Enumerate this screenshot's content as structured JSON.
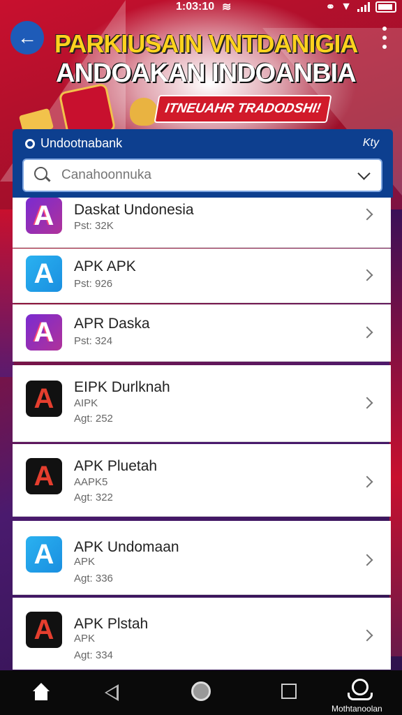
{
  "status_bar": {
    "time": "1:03:10"
  },
  "header": {
    "headline_line1": "PARKIUSAIN VNTDANIGIA",
    "headline_line2": "ANDOAKAN INDOANBIA",
    "promo_tag": "ITNEUAHR TRADODSHI!"
  },
  "panel": {
    "title": "Undootnabank",
    "right_label": "Kty",
    "search": {
      "placeholder": "Canahoonnuka"
    }
  },
  "apps": [
    {
      "title": "Daskat Undonesia",
      "sub1": "Pst: 32K",
      "sub2": "",
      "icon": "purple"
    },
    {
      "title": "APK APK",
      "sub1": "Pst: 926",
      "sub2": "",
      "icon": "blue"
    },
    {
      "title": "APR Daska",
      "sub1": "Pst: 324",
      "sub2": "",
      "icon": "purple"
    },
    {
      "title": "EIPK Durlknah",
      "sub1": "AIPK",
      "sub2": "Agt: 252",
      "icon": "black"
    },
    {
      "title": "APK Pluetah",
      "sub1": "AAPK5",
      "sub2": "Agt: 322",
      "icon": "black"
    },
    {
      "title": "APK Undomaan",
      "sub1": "APK",
      "sub2": "Agt: 336",
      "icon": "blue"
    },
    {
      "title": "APK Plstah",
      "sub1": "APK",
      "sub2": "Agt: 334",
      "icon": "black"
    }
  ],
  "icon_glyph": "A",
  "nav": {
    "profile_label": "Mothtanoolan"
  },
  "colors": {
    "panel_blue": "#0d3f8f",
    "accent_red": "#c8102e",
    "headline_yellow": "#ffd21e"
  }
}
